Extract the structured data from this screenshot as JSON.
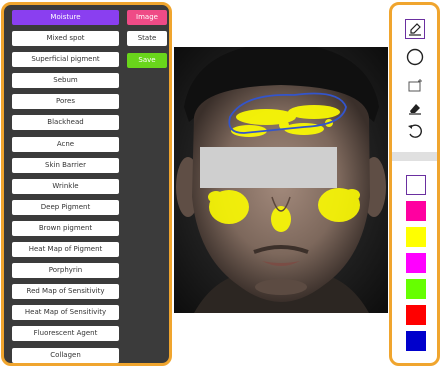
{
  "categories": [
    "Moisture",
    "Mixed spot",
    "Superficial pigment",
    "Sebum",
    "Pores",
    "Blackhead",
    "Acne",
    "Skin Barrier",
    "Wrinkle",
    "Deep Pigment",
    "Brown pigment",
    "Heat Map of Pigment",
    "Porphyrin",
    "Red Map of Sensitivity",
    "Heat Map of Sensitivity",
    "Fluorescent Agent",
    "Collagen"
  ],
  "active_category": "Moisture",
  "side_buttons": {
    "image": "Image",
    "state": "State",
    "save": "Save"
  },
  "tools": [
    "pencil-icon",
    "circle-icon",
    "rectangle-icon",
    "eraser-icon",
    "undo-icon"
  ],
  "swatches": [
    "#ffffff",
    "#ff00a0",
    "#ffff00",
    "#ff00ff",
    "#66ff00",
    "#ff0000",
    "#0000cc"
  ],
  "colors": {
    "accent_border": "#f0a52e",
    "active": "#8a3ff0",
    "image_btn": "#ef4b86",
    "save_btn": "#69d61b",
    "highlight": "#ffff00",
    "outline": "#3355cc"
  }
}
